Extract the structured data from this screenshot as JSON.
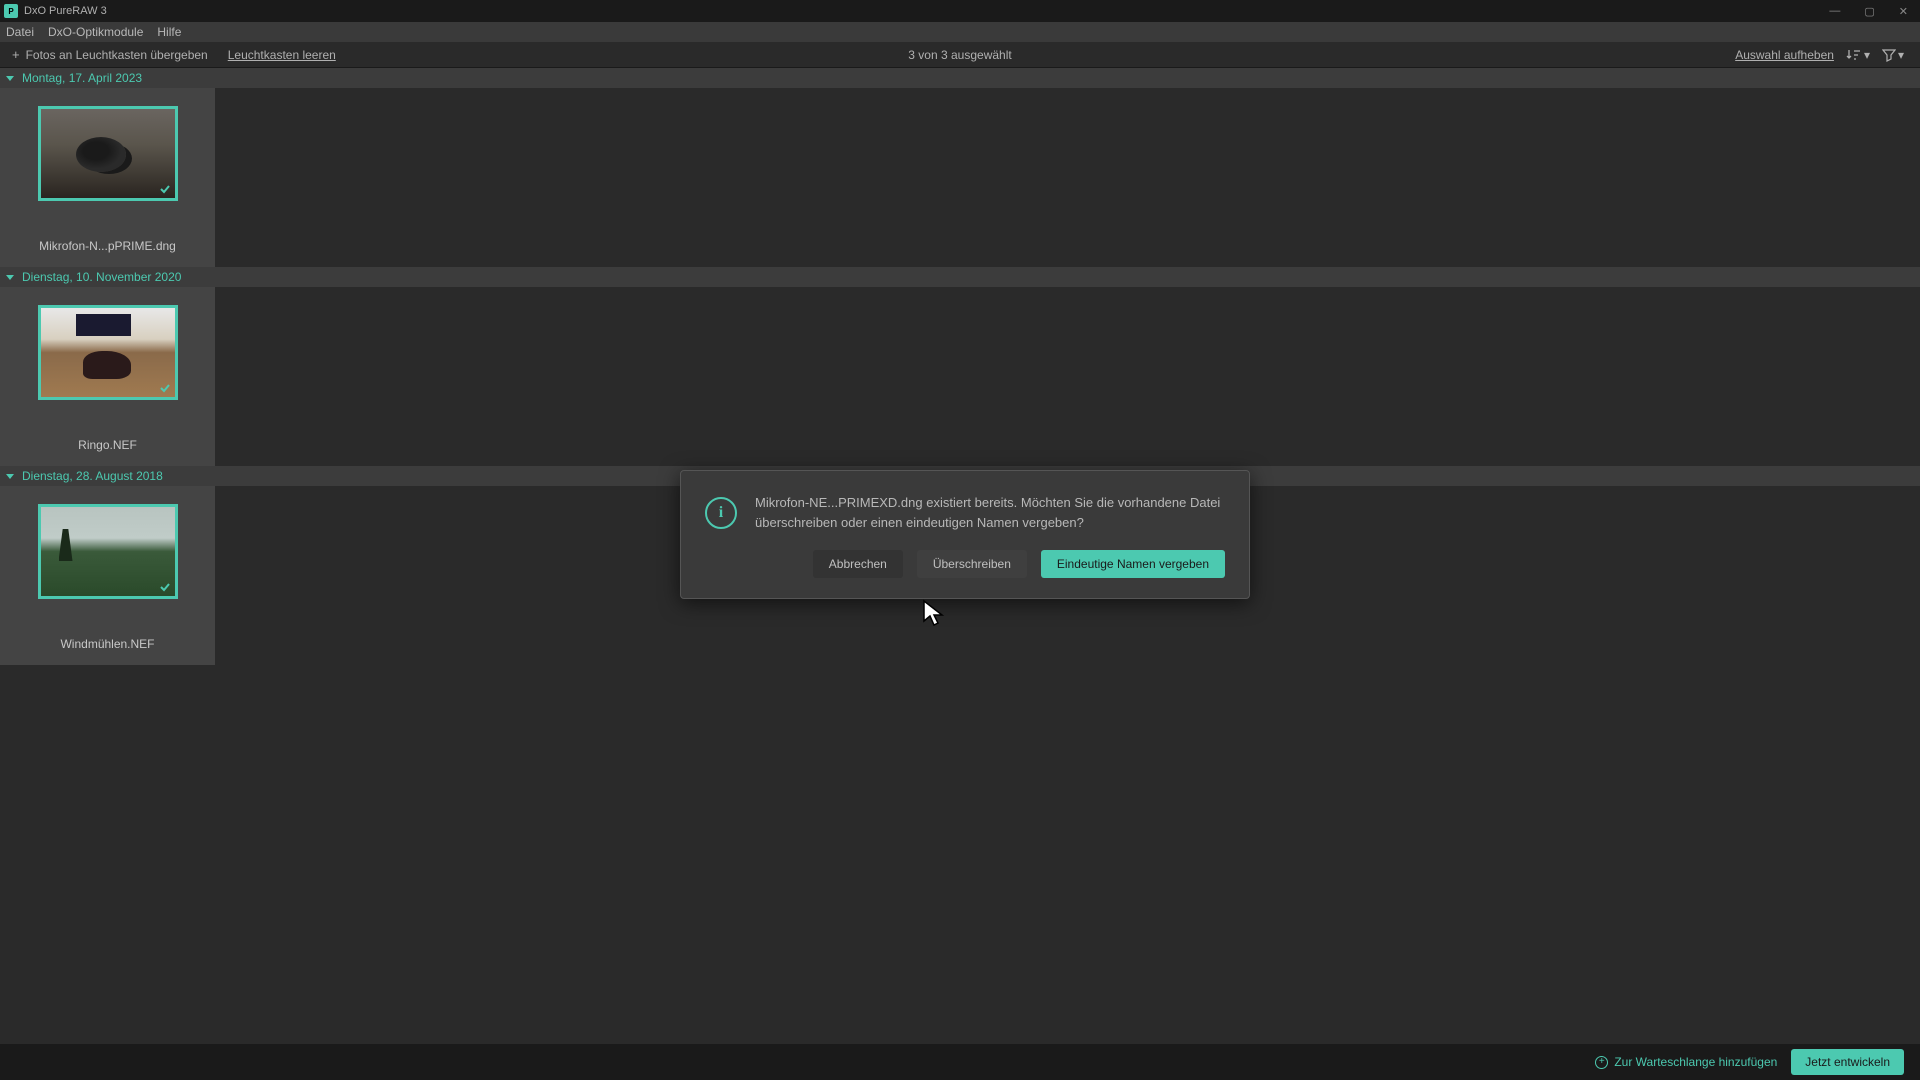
{
  "titlebar": {
    "app_name": "DxO PureRAW 3"
  },
  "menubar": {
    "file": "Datei",
    "optics": "DxO-Optikmodule",
    "help": "Hilfe"
  },
  "toolbar": {
    "add_photos": "Fotos an Leuchtkasten übergeben",
    "clear_lightbox": "Leuchtkasten leeren",
    "selection_count": "3 von 3 ausgewählt",
    "deselect": "Auswahl aufheben"
  },
  "groups": [
    {
      "date_label": "Montag, 17. April 2023",
      "thumb_label": "Mikrofon-N...pPRIME.dng"
    },
    {
      "date_label": "Dienstag, 10. November 2020",
      "thumb_label": "Ringo.NEF"
    },
    {
      "date_label": "Dienstag, 28. August 2018",
      "thumb_label": "Windmühlen.NEF"
    }
  ],
  "dialog": {
    "message": "Mikrofon-NE...PRIMEXD.dng existiert bereits. Möchten Sie die vorhandene Datei überschreiben oder einen eindeutigen Namen vergeben?",
    "cancel": "Abbrechen",
    "overwrite": "Überschreiben",
    "unique_names": "Eindeutige Namen vergeben"
  },
  "footer": {
    "add_to_queue": "Zur Warteschlange hinzufügen",
    "process_now": "Jetzt entwickeln"
  }
}
